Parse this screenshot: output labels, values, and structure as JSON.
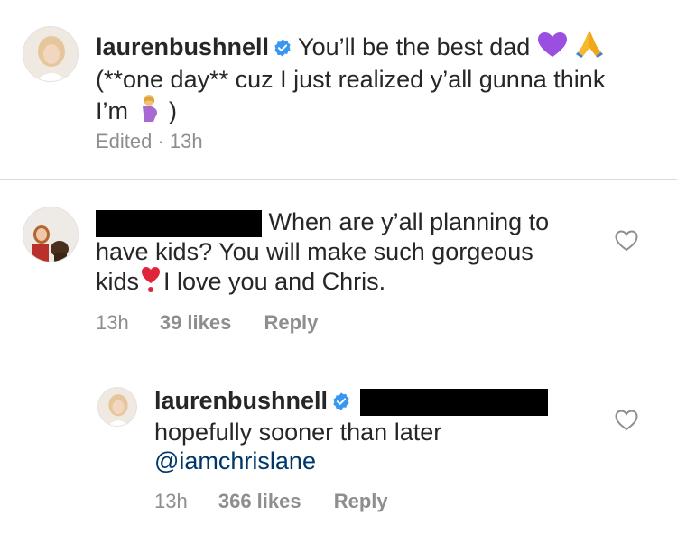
{
  "caption": {
    "username": "laurenbushnell",
    "line1": "You’ll be the best dad",
    "line2": "(**one day** cuz I just realized y’all gunna think",
    "line3_pre": "I’m",
    "line3_post": ")",
    "meta": "Edited · 13h"
  },
  "comment1": {
    "line1": "When are y’all planning to",
    "line2": "have kids? You will make such gorgeous",
    "line3_pre": "kids",
    "line3_post": "I love you and Chris.",
    "time": "13h",
    "likes": "39 likes",
    "reply_label": "Reply"
  },
  "reply1": {
    "username": "laurenbushnell",
    "line1": "hopefully sooner than later",
    "mention": "@iamchrislane",
    "time": "13h",
    "likes": "366 likes",
    "reply_label": "Reply"
  },
  "icons": {
    "verified": "verified-badge-icon",
    "purple_heart": "purple-heart-emoji",
    "pray": "folded-hands-emoji",
    "pregnant": "pregnant-woman-emoji",
    "red_exclamation": "heart-exclamation-emoji",
    "like": "heart-outline-icon"
  },
  "colors": {
    "text": "#262626",
    "meta": "#8e8e8e",
    "verified": "#3897f0",
    "mention": "#00376b"
  }
}
